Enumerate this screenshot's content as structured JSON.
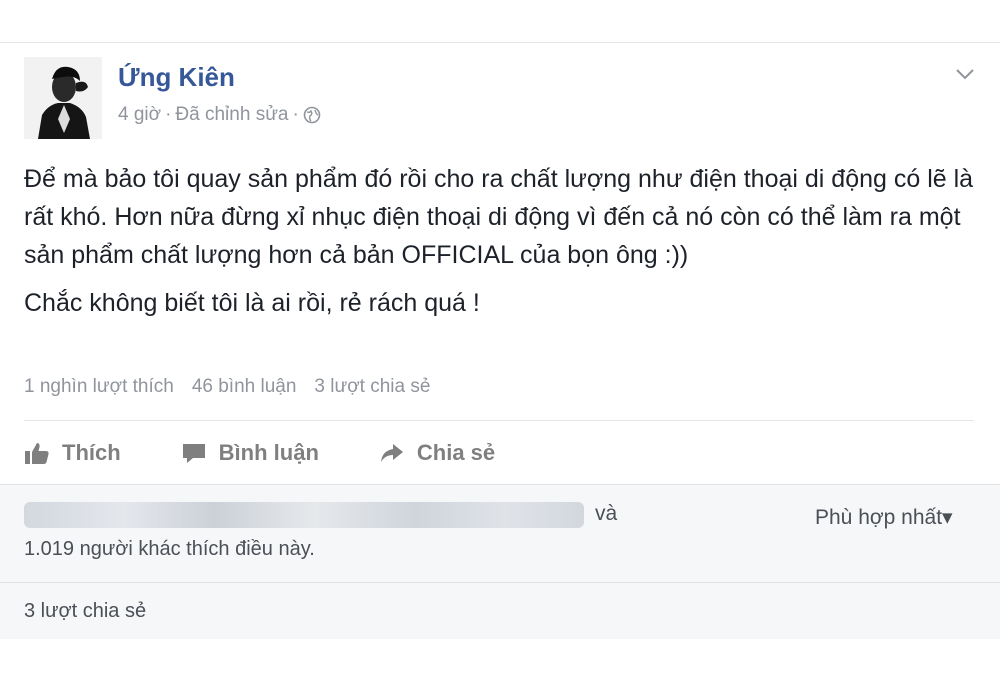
{
  "post": {
    "author": "Ứng Kiên",
    "time": "4 giờ",
    "edited": "Đã chỉnh sửa",
    "sep": "·",
    "privacy_icon": "globe-icon",
    "paragraphs": [
      "Để mà bảo tôi quay sản phẩm đó rồi cho ra chất lượng như điện thoại di động có lẽ là rất khó. Hơn nữa đừng xỉ nhục điện thoại di động vì đến cả nó còn có thể làm ra một sản phẩm chất lượng hơn cả bản OFFICIAL của bọn ông :))",
      "Chắc không biết tôi là ai rồi, rẻ rách quá !"
    ],
    "stats": {
      "likes": "1 nghìn lượt thích",
      "comments": "46 bình luận",
      "shares": "3 lượt chia sẻ"
    },
    "actions": {
      "like": "Thích",
      "comment": "Bình luận",
      "share": "Chia sẻ"
    }
  },
  "reactions": {
    "and_text": "và",
    "others_text": "1.019 người khác thích điều này.",
    "sort_label": "Phù hợp nhất",
    "sort_arrow": "▾",
    "shares_text": "3 lượt chia sẻ"
  },
  "colors": {
    "author": "#365899",
    "meta": "#90949c",
    "action": "#7f7f7f",
    "panel_bg": "#f6f7f9"
  }
}
